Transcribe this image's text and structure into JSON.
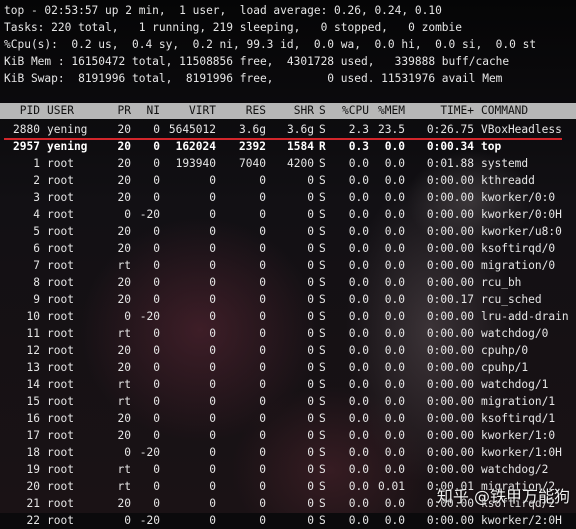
{
  "summary": [
    "top - 02:53:57 up 2 min,  1 user,  load average: 0.26, 0.24, 0.10",
    "Tasks: 220 total,   1 running, 219 sleeping,   0 stopped,   0 zombie",
    "%Cpu(s):  0.2 us,  0.4 sy,  0.2 ni, 99.3 id,  0.0 wa,  0.0 hi,  0.0 si,  0.0 st",
    "KiB Mem : 16150472 total, 11508856 free,  4301728 used,   339888 buff/cache",
    "KiB Swap:  8191996 total,  8191996 free,        0 used. 11531976 avail Mem"
  ],
  "columns": [
    "PID",
    "USER",
    "PR",
    "NI",
    "VIRT",
    "RES",
    "SHR",
    "S",
    "%CPU",
    "%MEM",
    "TIME+",
    "COMMAND"
  ],
  "processes": [
    [
      "2880",
      "yening",
      "20",
      "0",
      "5645012",
      "3.6g",
      "3.6g",
      "S",
      "2.3",
      "23.5",
      "0:26.75",
      "VBoxHeadless"
    ],
    [
      "2957",
      "yening",
      "20",
      "0",
      "162024",
      "2392",
      "1584",
      "R",
      "0.3",
      "0.0",
      "0:00.34",
      "top"
    ],
    [
      "1",
      "root",
      "20",
      "0",
      "193940",
      "7040",
      "4200",
      "S",
      "0.0",
      "0.0",
      "0:01.88",
      "systemd"
    ],
    [
      "2",
      "root",
      "20",
      "0",
      "0",
      "0",
      "0",
      "S",
      "0.0",
      "0.0",
      "0:00.00",
      "kthreadd"
    ],
    [
      "3",
      "root",
      "20",
      "0",
      "0",
      "0",
      "0",
      "S",
      "0.0",
      "0.0",
      "0:00.00",
      "kworker/0:0"
    ],
    [
      "4",
      "root",
      "0",
      "-20",
      "0",
      "0",
      "0",
      "S",
      "0.0",
      "0.0",
      "0:00.00",
      "kworker/0:0H"
    ],
    [
      "5",
      "root",
      "20",
      "0",
      "0",
      "0",
      "0",
      "S",
      "0.0",
      "0.0",
      "0:00.00",
      "kworker/u8:0"
    ],
    [
      "6",
      "root",
      "20",
      "0",
      "0",
      "0",
      "0",
      "S",
      "0.0",
      "0.0",
      "0:00.00",
      "ksoftirqd/0"
    ],
    [
      "7",
      "root",
      "rt",
      "0",
      "0",
      "0",
      "0",
      "S",
      "0.0",
      "0.0",
      "0:00.00",
      "migration/0"
    ],
    [
      "8",
      "root",
      "20",
      "0",
      "0",
      "0",
      "0",
      "S",
      "0.0",
      "0.0",
      "0:00.00",
      "rcu_bh"
    ],
    [
      "9",
      "root",
      "20",
      "0",
      "0",
      "0",
      "0",
      "S",
      "0.0",
      "0.0",
      "0:00.17",
      "rcu_sched"
    ],
    [
      "10",
      "root",
      "0",
      "-20",
      "0",
      "0",
      "0",
      "S",
      "0.0",
      "0.0",
      "0:00.00",
      "lru-add-drain"
    ],
    [
      "11",
      "root",
      "rt",
      "0",
      "0",
      "0",
      "0",
      "S",
      "0.0",
      "0.0",
      "0:00.00",
      "watchdog/0"
    ],
    [
      "12",
      "root",
      "20",
      "0",
      "0",
      "0",
      "0",
      "S",
      "0.0",
      "0.0",
      "0:00.00",
      "cpuhp/0"
    ],
    [
      "13",
      "root",
      "20",
      "0",
      "0",
      "0",
      "0",
      "S",
      "0.0",
      "0.0",
      "0:00.00",
      "cpuhp/1"
    ],
    [
      "14",
      "root",
      "rt",
      "0",
      "0",
      "0",
      "0",
      "S",
      "0.0",
      "0.0",
      "0:00.00",
      "watchdog/1"
    ],
    [
      "15",
      "root",
      "rt",
      "0",
      "0",
      "0",
      "0",
      "S",
      "0.0",
      "0.0",
      "0:00.00",
      "migration/1"
    ],
    [
      "16",
      "root",
      "20",
      "0",
      "0",
      "0",
      "0",
      "S",
      "0.0",
      "0.0",
      "0:00.00",
      "ksoftirqd/1"
    ],
    [
      "17",
      "root",
      "20",
      "0",
      "0",
      "0",
      "0",
      "S",
      "0.0",
      "0.0",
      "0:00.00",
      "kworker/1:0"
    ],
    [
      "18",
      "root",
      "0",
      "-20",
      "0",
      "0",
      "0",
      "S",
      "0.0",
      "0.0",
      "0:00.00",
      "kworker/1:0H"
    ],
    [
      "19",
      "root",
      "rt",
      "0",
      "0",
      "0",
      "0",
      "S",
      "0.0",
      "0.0",
      "0:00.00",
      "watchdog/2"
    ],
    [
      "20",
      "root",
      "rt",
      "0",
      "0",
      "0",
      "0",
      "S",
      "0.0",
      "0.01",
      "0:00.01",
      "migration/2"
    ],
    [
      "21",
      "root",
      "20",
      "0",
      "0",
      "0",
      "0",
      "S",
      "0.0",
      "0.0",
      "0:00.00",
      "ksoftirqd/2"
    ],
    [
      "22",
      "root",
      "0",
      "-20",
      "0",
      "0",
      "0",
      "S",
      "0.0",
      "0.0",
      "0:00.00",
      "kworker/2:0H"
    ]
  ],
  "watermark": "知乎 @铁甲万能狗"
}
